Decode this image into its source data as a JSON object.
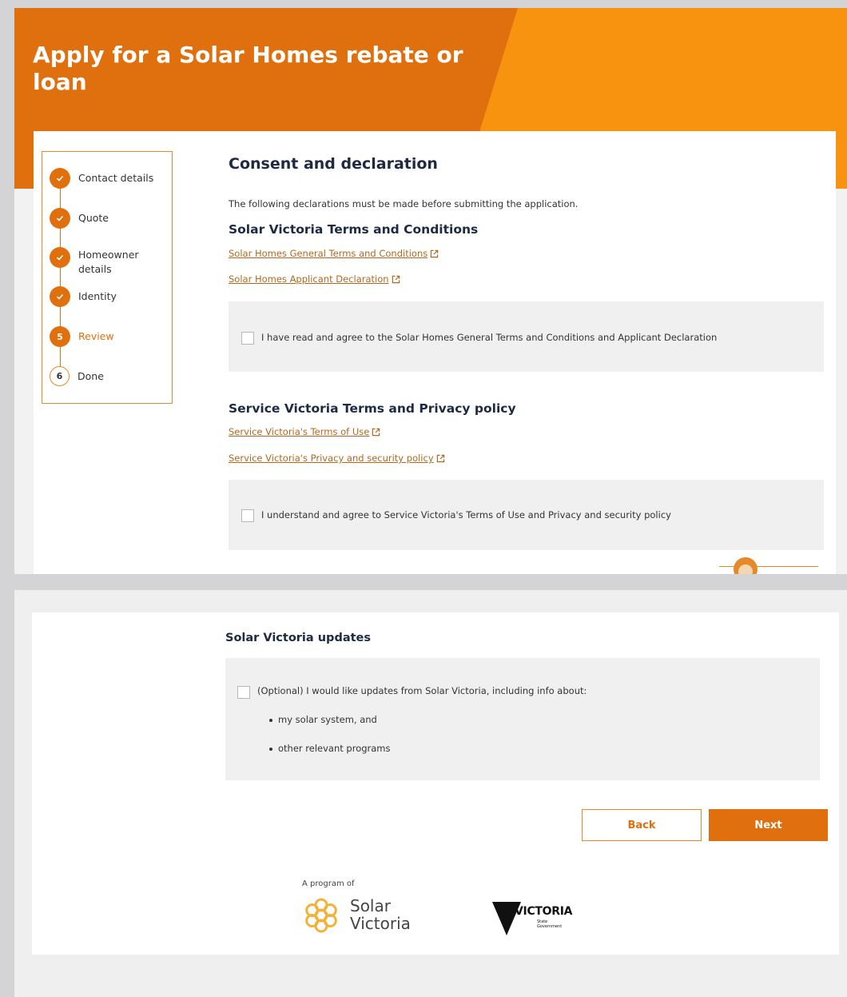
{
  "hero": {
    "title": "Apply for a Solar Homes rebate or loan"
  },
  "stepper": {
    "steps": [
      {
        "marker": "",
        "label": "Contact details",
        "state": "complete"
      },
      {
        "marker": "",
        "label": "Quote",
        "state": "complete"
      },
      {
        "marker": "",
        "label": "Homeowner details",
        "state": "complete"
      },
      {
        "marker": "",
        "label": "Identity",
        "state": "complete"
      },
      {
        "marker": "5",
        "label": "Review",
        "state": "current"
      },
      {
        "marker": "6",
        "label": "Done",
        "state": "upcoming"
      }
    ]
  },
  "consent": {
    "heading": "Consent and declaration",
    "intro": "The following declarations must be made before submitting the application.",
    "solar_terms": {
      "heading": "Solar Victoria Terms and Conditions",
      "links": [
        "Solar Homes General Terms and Conditions",
        "Solar Homes Applicant Declaration"
      ],
      "checkbox_label": "I have read and agree to the Solar Homes General Terms and Conditions and Applicant Declaration",
      "checked": false
    },
    "service_terms": {
      "heading": "Service Victoria Terms and Privacy policy",
      "links": [
        "Service Victoria's Terms of Use",
        "Service Victoria's Privacy and security policy"
      ],
      "checkbox_label": "I understand and agree to Service Victoria's Terms of Use and Privacy and security policy",
      "checked": false
    }
  },
  "updates": {
    "heading": "Solar Victoria updates",
    "checkbox_label": "(Optional) I would like updates from Solar Victoria, including info about:",
    "checked": false,
    "bullets": [
      "my solar system, and",
      "other relevant programs"
    ]
  },
  "actions": {
    "back_label": "Back",
    "next_label": "Next"
  },
  "footer": {
    "program_label": "A program of",
    "solar_logo": {
      "line1": "Solar",
      "line2": "Victoria"
    },
    "vic_logo": {
      "word": "VICTORIA",
      "sub1": "State",
      "sub2": "Government"
    }
  },
  "icons": {
    "step_complete": "check-icon",
    "external_link": "external-link-icon",
    "chat": "chat-assistant-icon"
  },
  "colors": {
    "brand_orange": "#f7930e",
    "brand_dark_orange": "#e0700e",
    "heading_navy": "#1e2a44",
    "link_brown": "#b3681d",
    "panel_grey": "#f0f0f0"
  }
}
